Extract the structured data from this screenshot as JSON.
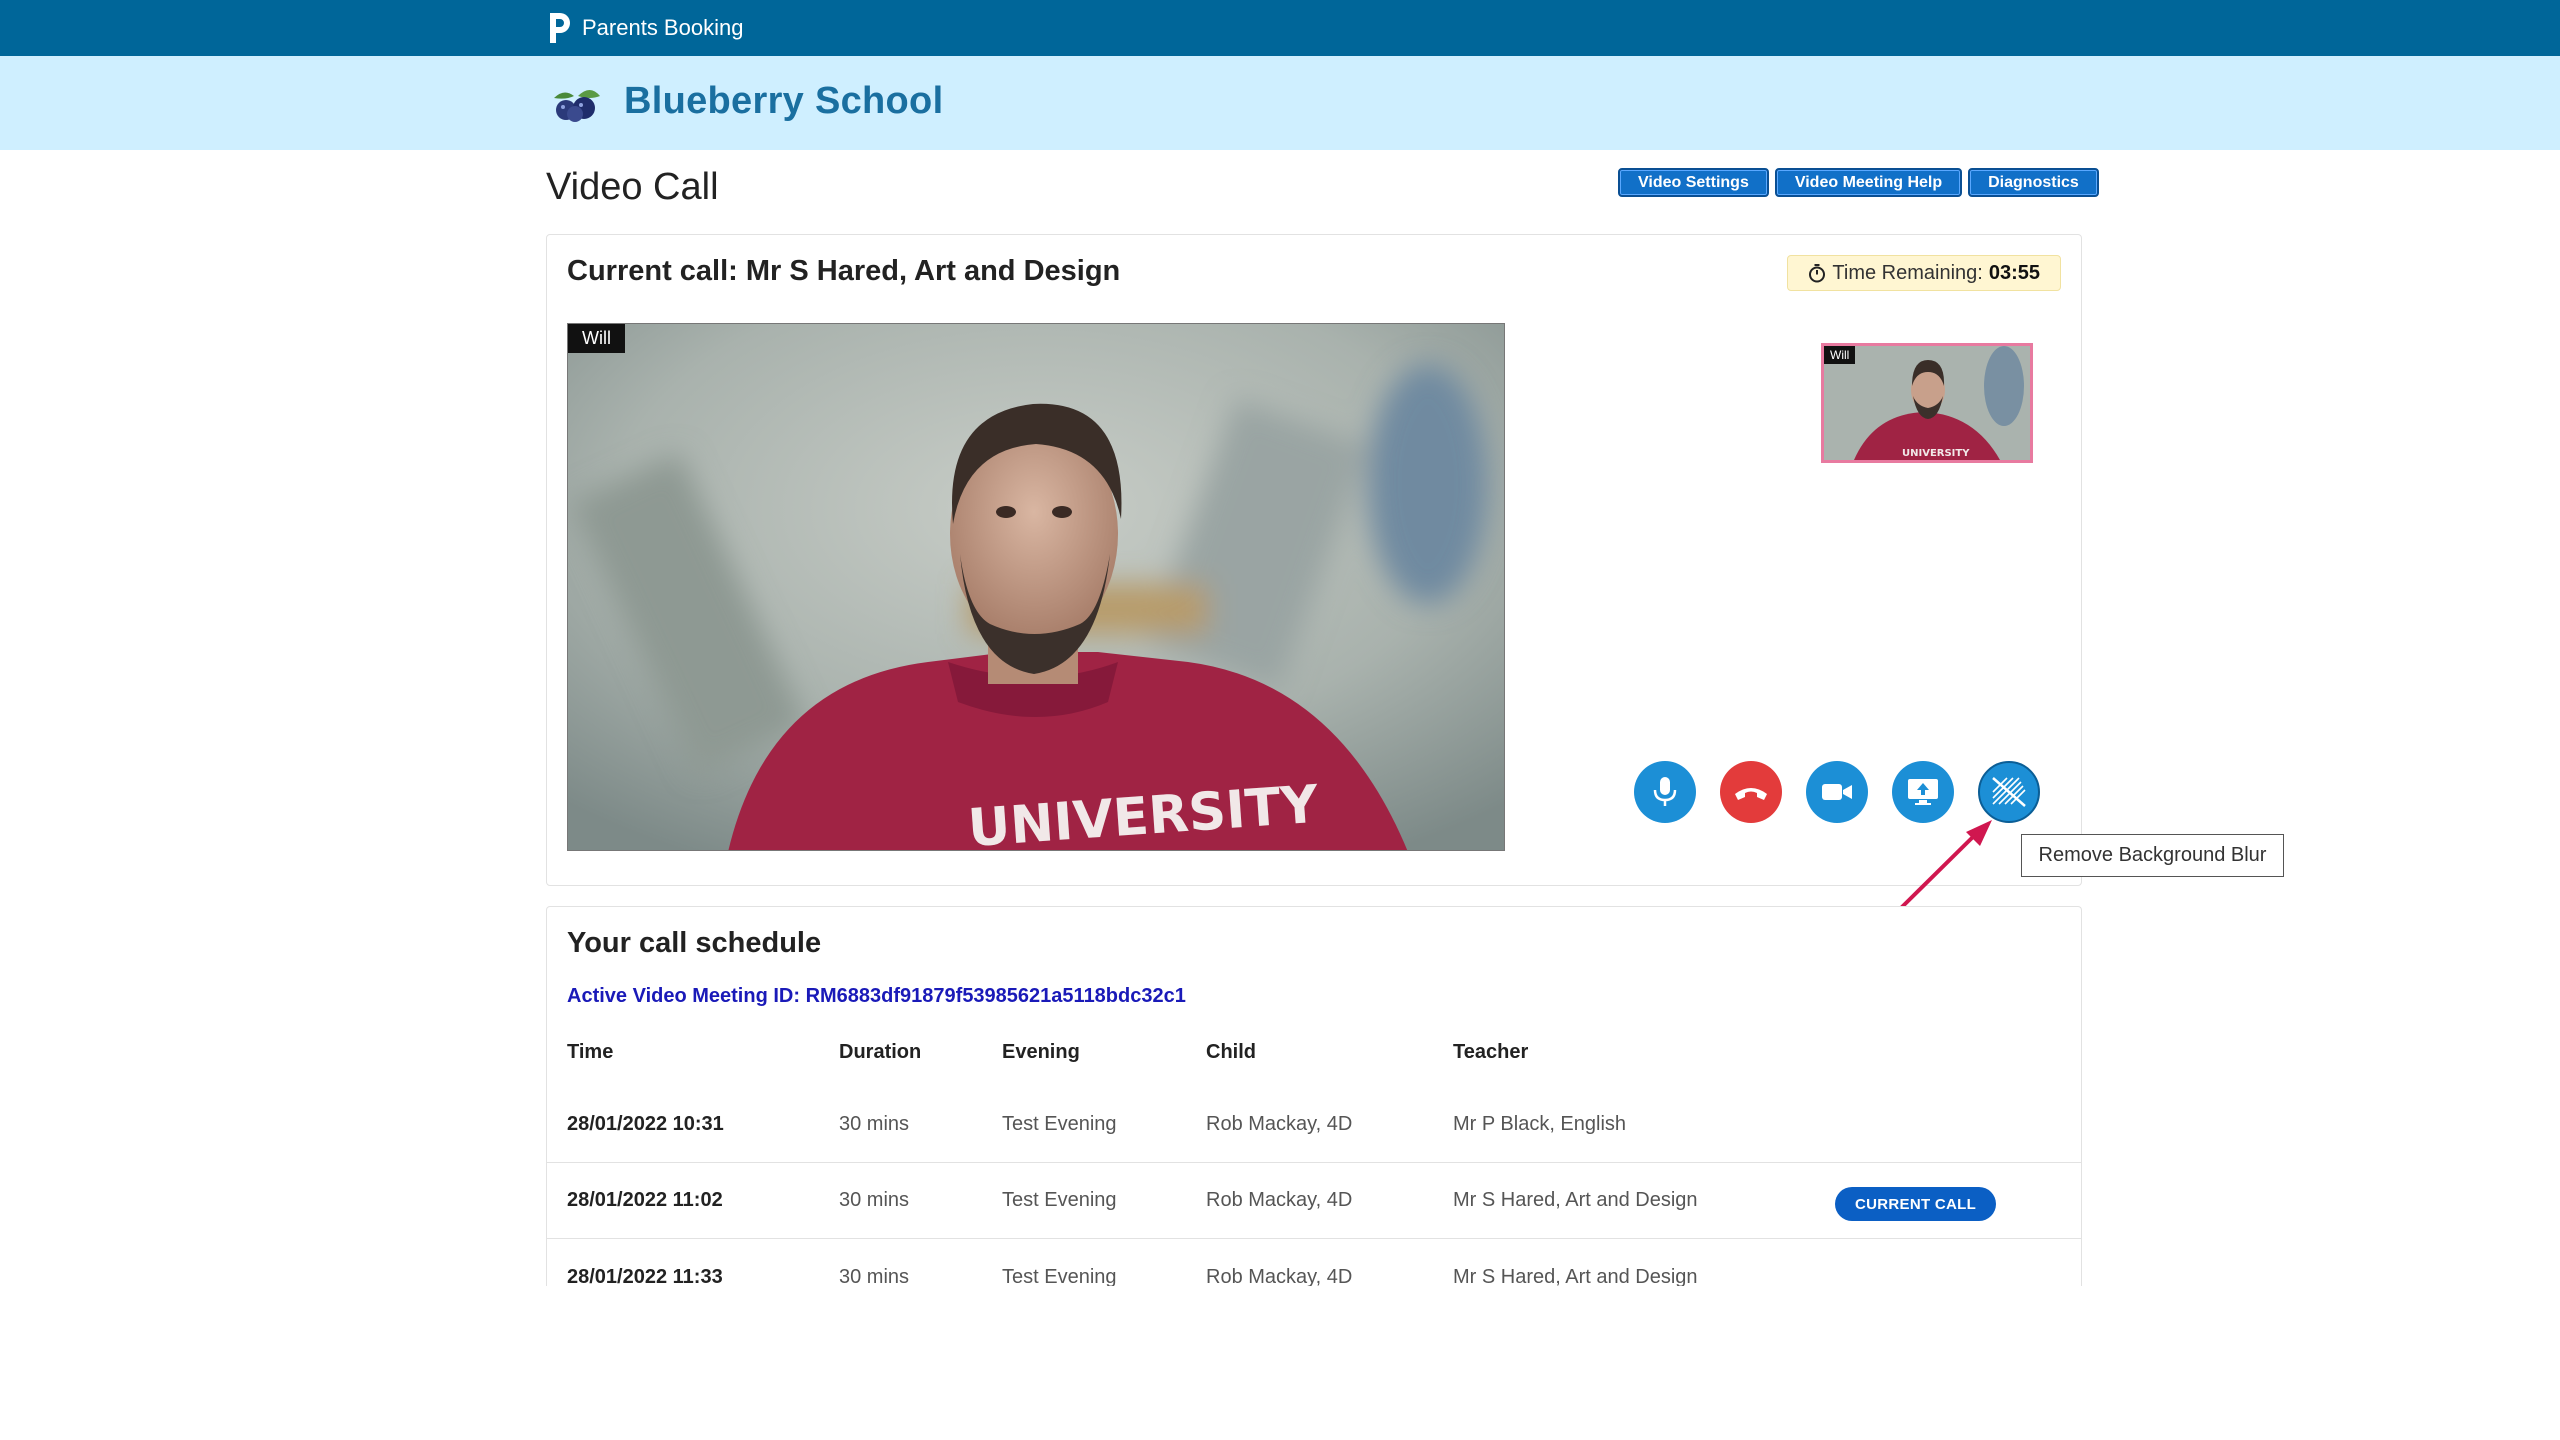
{
  "brand": {
    "name": "Parents Booking"
  },
  "school": {
    "name": "Blueberry School"
  },
  "page": {
    "title": "Video Call"
  },
  "help_buttons": [
    "Video Settings",
    "Video Meeting Help",
    "Diagnostics"
  ],
  "call": {
    "title": "Current call: Mr S Hared, Art and Design",
    "timer_label": "Time Remaining:",
    "timer_value": "03:55",
    "main_video_label": "Will",
    "pip_label": "Will",
    "controls": [
      "microphone-icon",
      "hang-up-icon",
      "camera-icon",
      "screen-share-icon",
      "background-blur-off-icon"
    ],
    "tooltip": "Remove Background Blur"
  },
  "schedule": {
    "title": "Your call schedule",
    "meeting_id": "Active Video Meeting ID: RM6883df91879f53985621a5118bdc32c1",
    "columns": [
      "Time",
      "Duration",
      "Evening",
      "Child",
      "Teacher"
    ],
    "rows": [
      {
        "time": "28/01/2022 10:31",
        "duration": "30 mins",
        "evening": "Test Evening",
        "child": "Rob Mackay, 4D",
        "teacher": "Mr P Black, English",
        "badge": ""
      },
      {
        "time": "28/01/2022 11:02",
        "duration": "30 mins",
        "evening": "Test Evening",
        "child": "Rob Mackay, 4D",
        "teacher": "Mr S Hared, Art and Design",
        "badge": "CURRENT CALL"
      },
      {
        "time": "28/01/2022 11:33",
        "duration": "30 mins",
        "evening": "Test Evening",
        "child": "Rob Mackay, 4D",
        "teacher": "Mr S Hared, Art and Design",
        "badge": ""
      }
    ]
  },
  "colors": {
    "topbar": "#006699",
    "schoolbar": "#cfefff",
    "accent": "#1c8fd6",
    "hangup": "#e33b3b",
    "arrow": "#d0174f"
  }
}
